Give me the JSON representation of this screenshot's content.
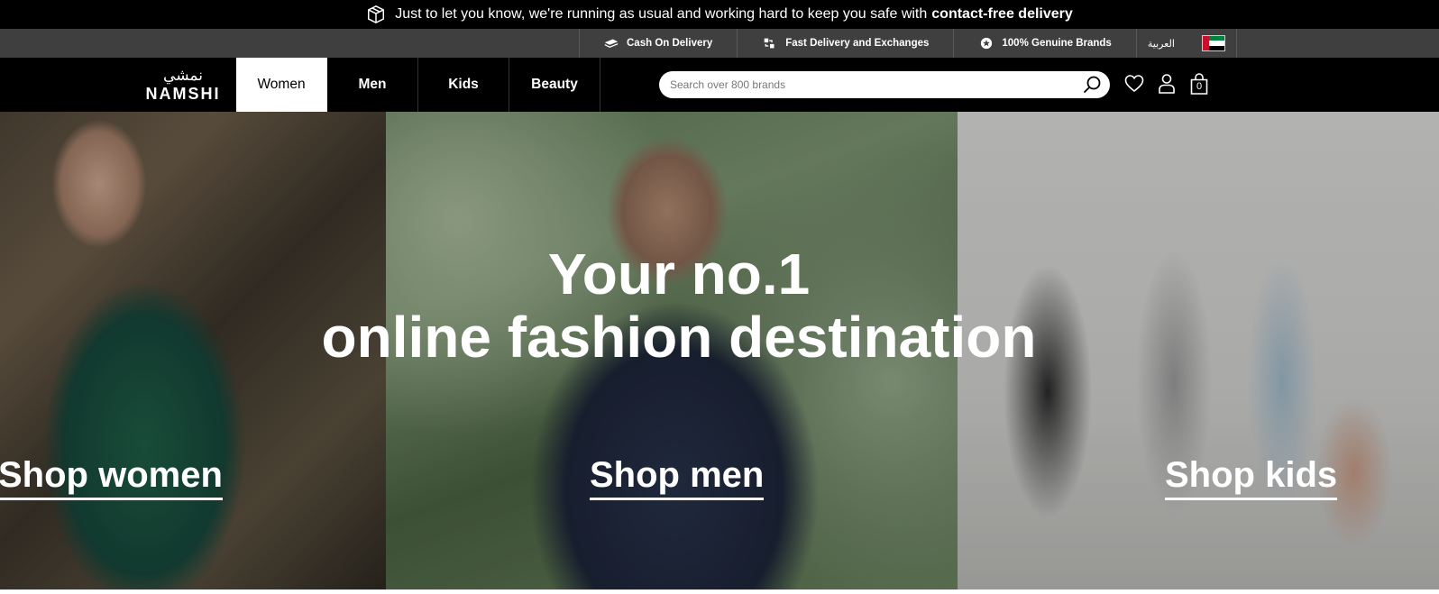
{
  "announcement": {
    "text": "Just to let you know, we're running as usual and working hard to keep you safe with",
    "bold_text": "contact-free delivery",
    "icon": "package-icon"
  },
  "utility_bar": {
    "items": [
      {
        "label": "Cash On Delivery",
        "icon": "cash-icon"
      },
      {
        "label": "Fast Delivery and Exchanges",
        "icon": "exchange-icon"
      },
      {
        "label": "100% Genuine Brands",
        "icon": "star-badge-icon"
      }
    ],
    "language": "العربية",
    "flag": "uae-flag"
  },
  "nav": {
    "logo_arabic": "نمشي",
    "logo_latin": "NAMSHI",
    "tabs": [
      "Women",
      "Men",
      "Kids",
      "Beauty"
    ],
    "active_tab": "Women",
    "search_placeholder": "Search over 800 brands",
    "cart_count": "0"
  },
  "hero": {
    "headline_line1": "Your no.1",
    "headline_line2": "online fashion destination",
    "shop_women": "Shop women",
    "shop_men": "Shop men",
    "shop_kids": "Shop kids"
  },
  "colors": {
    "top_bar": "#000000",
    "utility_bar": "#3f3f3f",
    "accent": "#ffffff"
  }
}
